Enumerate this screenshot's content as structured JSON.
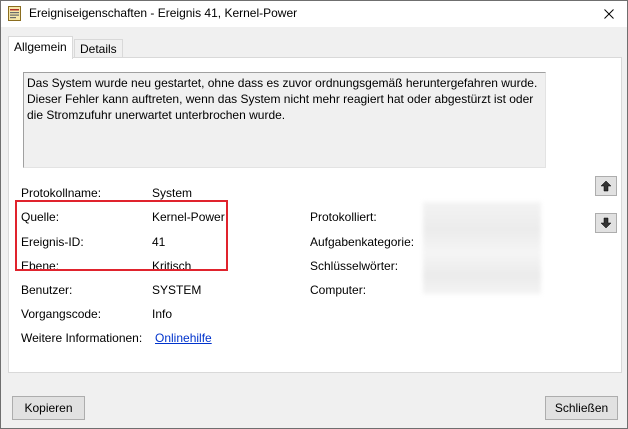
{
  "window": {
    "title": "Ereigniseigenschaften - Ereignis 41, Kernel-Power",
    "app_icon": "event-viewer-icon",
    "close_icon": "close-icon"
  },
  "tabs": [
    {
      "label": "Allgemein",
      "active": true
    },
    {
      "label": "Details",
      "active": false
    }
  ],
  "description": "Das System wurde neu gestartet, ohne dass es zuvor ordnungsgemäß heruntergefahren wurde. Dieser Fehler kann auftreten, wenn das System nicht mehr reagiert hat oder abgestürzt ist oder die Stromzufuhr unerwartet unterbrochen wurde.",
  "fields_left": [
    {
      "label": "Protokollname:",
      "value": "System"
    },
    {
      "label": "Quelle:",
      "value": "Kernel-Power"
    },
    {
      "label": "Ereignis-ID:",
      "value": "41"
    },
    {
      "label": "Ebene:",
      "value": "Kritisch"
    },
    {
      "label": "Benutzer:",
      "value": "SYSTEM"
    },
    {
      "label": "Vorgangscode:",
      "value": "Info"
    },
    {
      "label": "Weitere Informationen:",
      "value": "Onlinehilfe"
    }
  ],
  "fields_right": [
    {
      "label": "Protokolliert:"
    },
    {
      "label": "Aufgabenkategorie:"
    },
    {
      "label": "Schlüsselwörter:"
    },
    {
      "label": "Computer:"
    }
  ],
  "nav": {
    "up_icon": "arrow-up-icon",
    "down_icon": "arrow-down-icon"
  },
  "buttons": {
    "copy": "Kopieren",
    "close": "Schließen"
  },
  "colors": {
    "highlight": "#e0232d",
    "link": "#0033cc"
  }
}
